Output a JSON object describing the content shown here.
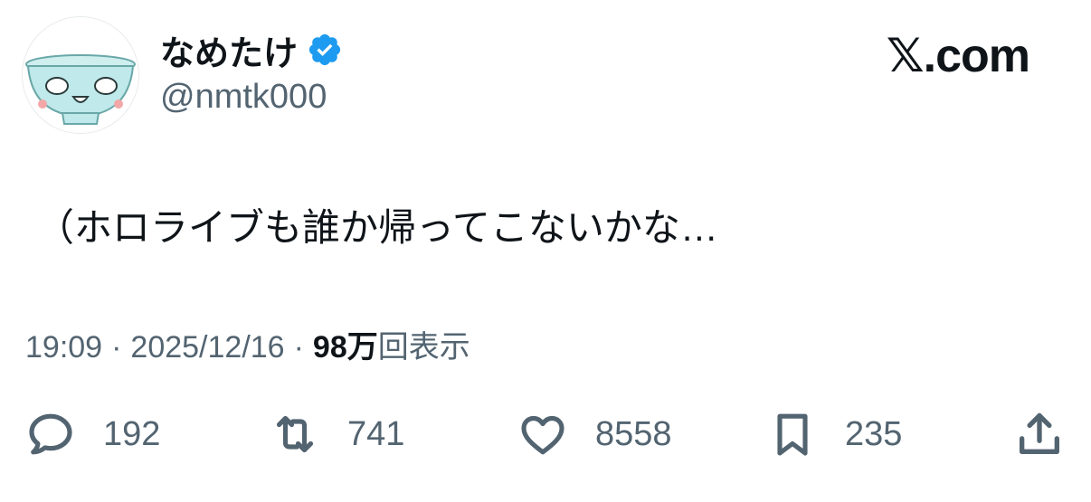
{
  "user": {
    "display_name": "なめたけ",
    "handle": "@nmtk000",
    "verified": true,
    "avatar": "bowl-face-avatar"
  },
  "brand": {
    "label": "𝕏.com"
  },
  "tweet": {
    "text": "（ホロライブも誰か帰ってこないかな…"
  },
  "meta": {
    "time": "19:09",
    "separator": "·",
    "date": "2025/12/16",
    "views_number": "98万",
    "views_label": "回表示"
  },
  "actions": {
    "replies": "192",
    "reposts": "741",
    "likes": "8558",
    "bookmarks": "235"
  },
  "icons": {
    "verified": "verified-badge-icon",
    "reply": "reply-bubble-icon",
    "repost": "repost-icon",
    "like": "heart-icon",
    "bookmark": "bookmark-icon",
    "share": "share-icon"
  },
  "colors": {
    "text_primary": "#0f1419",
    "text_secondary": "#536471",
    "verified_blue": "#1d9bf0"
  }
}
